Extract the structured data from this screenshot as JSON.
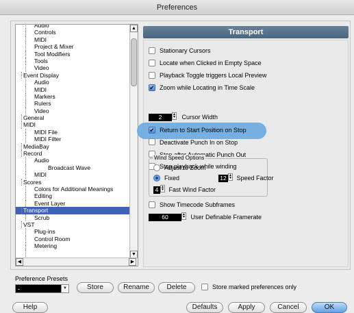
{
  "window": {
    "title": "Preferences"
  },
  "tree": {
    "items": [
      {
        "label": "Audio",
        "indent": 2
      },
      {
        "label": "Controls",
        "indent": 2
      },
      {
        "label": "MIDI",
        "indent": 2
      },
      {
        "label": "Project & Mixer",
        "indent": 2
      },
      {
        "label": "Tool Modifiers",
        "indent": 2
      },
      {
        "label": "Tools",
        "indent": 2
      },
      {
        "label": "Video",
        "indent": 2
      },
      {
        "label": "Event Display",
        "indent": 1
      },
      {
        "label": "Audio",
        "indent": 2
      },
      {
        "label": "MIDI",
        "indent": 2
      },
      {
        "label": "Markers",
        "indent": 2
      },
      {
        "label": "Rulers",
        "indent": 2
      },
      {
        "label": "Video",
        "indent": 2
      },
      {
        "label": "General",
        "indent": 1
      },
      {
        "label": "MIDI",
        "indent": 1
      },
      {
        "label": "MIDI File",
        "indent": 2
      },
      {
        "label": "MIDI Filter",
        "indent": 2
      },
      {
        "label": "MediaBay",
        "indent": 1
      },
      {
        "label": "Record",
        "indent": 1
      },
      {
        "label": "Audio",
        "indent": 2
      },
      {
        "label": "Broadcast Wave",
        "indent": 3
      },
      {
        "label": "MIDI",
        "indent": 2
      },
      {
        "label": "Scores",
        "indent": 1
      },
      {
        "label": "Colors for Additional Meanings",
        "indent": 2
      },
      {
        "label": "Editing",
        "indent": 2
      },
      {
        "label": "Event Layer",
        "indent": 2
      },
      {
        "label": "Transport",
        "indent": 1,
        "selected": true
      },
      {
        "label": "Scrub",
        "indent": 2
      },
      {
        "label": "VST",
        "indent": 1
      },
      {
        "label": "Plug-ins",
        "indent": 2
      },
      {
        "label": "Control Room",
        "indent": 2
      },
      {
        "label": "Metering",
        "indent": 2
      },
      {
        "label": "",
        "indent": 2
      }
    ]
  },
  "panel": {
    "title": "Transport",
    "options": [
      {
        "label": "Stationary Cursors",
        "checked": false
      },
      {
        "label": "Locate when Clicked in Empty Space",
        "checked": false
      },
      {
        "label": "Playback Toggle triggers Local Preview",
        "checked": false
      },
      {
        "label": "Zoom while Locating in Time Scale",
        "checked": true
      }
    ],
    "cursor_width": {
      "value": "2",
      "label": "Cursor Width"
    },
    "options2": [
      {
        "label": "Return to Start Position on Stop",
        "checked": true
      },
      {
        "label": "Deactivate Punch In on Stop",
        "checked": false
      },
      {
        "label": "Stop after Automatic Punch Out",
        "checked": false
      },
      {
        "label": "Stop playback while winding",
        "checked": false
      }
    ],
    "wind_speed": {
      "group_label": "Wind Speed Options",
      "adjust_to_zoom": "Adjust to Zoom",
      "fixed": "Fixed",
      "speed_factor_value": "12",
      "speed_factor_label": "Speed Factor",
      "fast_wind_value": "4",
      "fast_wind_label": "Fast Wind Factor"
    },
    "show_timecode": {
      "label": "Show Timecode Subframes",
      "checked": false
    },
    "framerate": {
      "value": "60",
      "label": "User Definable Framerate"
    }
  },
  "presets": {
    "label": "Preference Presets",
    "selected": "-",
    "store": "Store",
    "rename": "Rename",
    "delete": "Delete",
    "store_marked": "Store marked preferences only"
  },
  "footer": {
    "help": "Help",
    "defaults": "Defaults",
    "apply": "Apply",
    "cancel": "Cancel",
    "ok": "OK"
  },
  "colors": {
    "accent": "#3d63b8",
    "header": "#55708a",
    "highlight": "#62a4df"
  }
}
